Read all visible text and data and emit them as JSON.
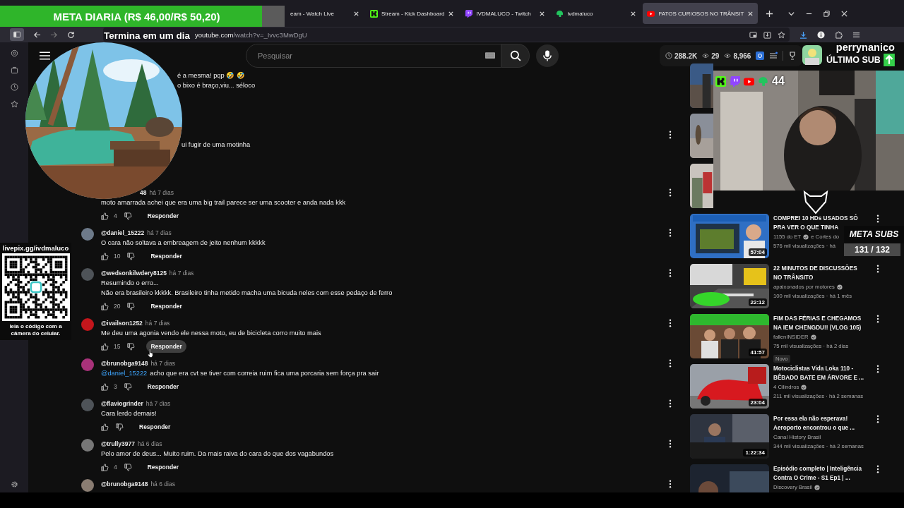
{
  "stream_overlay": {
    "goal_bar": {
      "text": "META DIARIA (R$ 46,00/R$ 50,20)",
      "level": 0.92
    },
    "timer": "Termina em um dia",
    "qr": {
      "url": "livepix.gg/ivdmaluco",
      "caption": "leia o código com a câmera do celular."
    },
    "platform_count": "44",
    "last_sub": {
      "name": "perrynanico",
      "label": "ÚLTIMO SUB"
    },
    "sub_goal": {
      "title": "META SUBS",
      "count": "131 / 132"
    }
  },
  "browser": {
    "tabs": [
      {
        "title": "eam - Watch Live",
        "kind": "plain",
        "selected": false
      },
      {
        "title": "Stream - Kick Dashboard",
        "kind": "kick",
        "selected": false
      },
      {
        "title": "IVDMALUCO - Twitch",
        "kind": "twitch",
        "selected": false
      },
      {
        "title": "ivdmaluco",
        "kind": "leaf",
        "selected": false
      },
      {
        "title": "FATOS CURIOSOS NO TRÂNSIT",
        "kind": "youtube",
        "selected": true
      }
    ],
    "address": {
      "host": "youtube.com",
      "path": "/watch?v=_Ivvc3MwDgU"
    }
  },
  "header": {
    "search": {
      "placeholder": "Pesquisar"
    },
    "stats": [
      {
        "kind": "clock",
        "value": "288.2K"
      },
      {
        "kind": "eye",
        "value": "29"
      },
      {
        "kind": "eye",
        "value": "8,966"
      }
    ]
  },
  "comments": [
    {
      "kind": "covered",
      "lines": [
        "é a mesma! pqp 🤣 🤣",
        "o bixo é braço,viu... séloco"
      ]
    },
    {
      "kind": "covered",
      "lines": [
        "ui fugir de uma motinha"
      ],
      "menu_button": true
    },
    {
      "kind": "partial",
      "author": "48",
      "time": "há 7 dias",
      "lines": [
        "moto amarrada achei que era uma big trail parece ser uma scooter e anda nada kkk"
      ],
      "likes": "4",
      "reply": "Responder",
      "reply_hovered": false,
      "menu_button": true
    },
    {
      "kind": "full",
      "author": "@daniel_15222",
      "time": "há 7 dias",
      "lines": [
        "O cara não soltava a embreagem de jeito nenhum kkkkk"
      ],
      "likes": "10",
      "reply": "Responder",
      "reply_hovered": false,
      "menu_button": true
    },
    {
      "kind": "full",
      "author": "@wedsonkilwdery8125",
      "time": "há 7 dias",
      "lines": [
        "Resumindo o erro...",
        "Não era brasileiro kkkkk. Brasileiro tinha metido macha uma bicuda neles com esse pedaço de ferro"
      ],
      "likes": "20",
      "reply": "Responder",
      "reply_hovered": false,
      "menu_button": true
    },
    {
      "kind": "full",
      "author": "@ivailson1252",
      "time": "há 7 dias",
      "lines": [
        "Me deu uma agonia vendo ele nessa moto, eu de bicicleta corro muito mais"
      ],
      "likes": "15",
      "reply": "Responder",
      "reply_hovered": true,
      "menu_button": true
    },
    {
      "kind": "full",
      "author": "@brunobga9148",
      "time": "há 7 dias",
      "mention": "@daniel_15222",
      "lines": [
        "acho que era cvt se tiver com correia ruim fica uma porcaria sem força pra sair"
      ],
      "likes": "3",
      "reply": "Responder",
      "reply_hovered": false,
      "menu_button": true
    },
    {
      "kind": "full",
      "author": "@flaviogrinder",
      "time": "há 7 dias",
      "lines": [
        "Cara lerdo demais!"
      ],
      "reply": "Responder",
      "reply_hovered": false,
      "menu_button": true
    },
    {
      "kind": "full",
      "author": "@trully3977",
      "time": "há 6 dias",
      "lines": [
        "Pelo amor de deus... Muito ruim. Da mais raiva do cara do que dos vagabundos"
      ],
      "likes": "4",
      "reply": "Responder",
      "reply_hovered": false,
      "menu_button": true
    },
    {
      "kind": "full",
      "author": "@brunobga9148",
      "time": "há 6 dias",
      "menu_button": true
    }
  ],
  "recommendations": [
    {
      "kind": "covered"
    },
    {
      "kind": "covered"
    },
    {
      "kind": "covered"
    },
    {
      "kind": "video",
      "title_lines": [
        "COMPREI 10 HDs USADOS SÓ",
        "PRA VER O QUE TINHA"
      ],
      "channel": "1155 do ET",
      "verified": true,
      "channel_extra": "e Cortes do",
      "views": "576 mil visualizações · há",
      "duration": "57:04",
      "menu_button": true
    },
    {
      "kind": "video",
      "title_lines": [
        "22 MINUTOS DE DISCUSSÕES",
        "NO TRÂNSITO"
      ],
      "channel": "apaixonados por motores",
      "verified": true,
      "views": "100 mil visualizações · há 1 mês",
      "duration": "22:12",
      "menu_button": true
    },
    {
      "kind": "video",
      "title_lines": [
        "FIM DAS FÉRIAS E CHEGAMOS",
        "NA IEM CHENGDU!! (VLOG 105)"
      ],
      "channel": "fallenINSIDER",
      "verified": true,
      "views": "75 mil visualizações · há 2 dias",
      "badge": "Novo",
      "duration": "41:57",
      "menu_button": true
    },
    {
      "kind": "video",
      "title_lines": [
        "Motociclistas Vida Loka 110 -",
        "BÊBADO BATE EM ÁRVORE E ..."
      ],
      "channel": "4 Cilindros",
      "verified": true,
      "views": "211 mil visualizações · há 2 semanas",
      "duration": "23:04",
      "menu_button": true
    },
    {
      "kind": "video",
      "title_lines": [
        "Por essa ela não esperava!",
        "Aeroporto encontrou o que ..."
      ],
      "channel": "Canal History Brasil",
      "verified": false,
      "views": "344 mil visualizações · há 2 semanas",
      "duration": "1:22:34",
      "menu_button": true
    },
    {
      "kind": "video",
      "title_lines": [
        "Episódio completo | Inteligência",
        "Contra O Crime - S1 Ep1 | ..."
      ],
      "channel": "Discovery Brasil",
      "verified": true,
      "menu_button": true
    }
  ]
}
